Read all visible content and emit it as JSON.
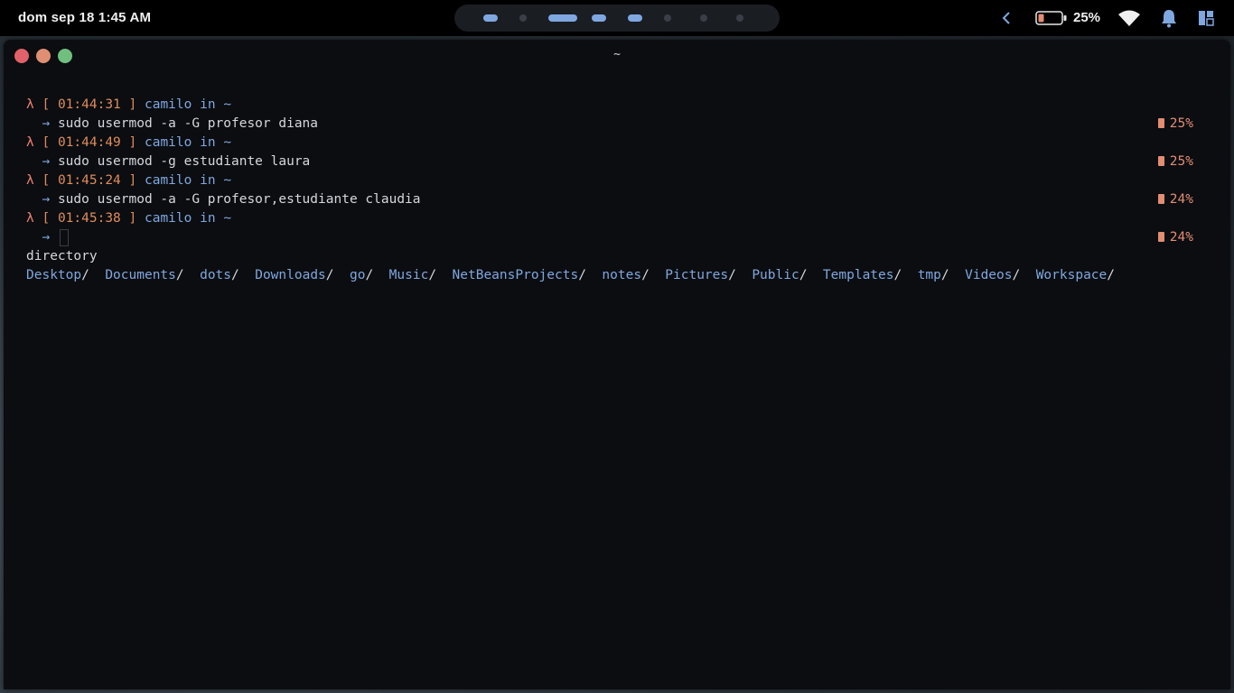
{
  "topbar": {
    "clock": "dom sep 18  1:45 AM",
    "battery_percent": "25%",
    "workspaces": [
      {
        "state": "active",
        "width": 16
      },
      {
        "state": "inactive",
        "width": 8
      },
      {
        "state": "active",
        "width": 32
      },
      {
        "state": "active",
        "width": 16
      },
      {
        "state": "active",
        "width": 16
      },
      {
        "state": "inactive",
        "width": 8
      },
      {
        "state": "inactive",
        "width": 8
      },
      {
        "state": "inactive",
        "width": 8
      }
    ],
    "icons": [
      "chevron-left-icon",
      "battery-icon",
      "wifi-icon",
      "bell-icon",
      "panel-icon"
    ]
  },
  "window": {
    "title": "~",
    "controls": [
      "close",
      "minimize",
      "maximize"
    ]
  },
  "terminal": {
    "prompts": [
      {
        "lambda": "λ",
        "open": "[",
        "time": "01:44:31",
        "close": "]",
        "user": "camilo",
        "in": "in",
        "dir": "~",
        "arrow": "→",
        "command": "sudo usermod -a -G profesor diana",
        "battery": "25%"
      },
      {
        "lambda": "λ",
        "open": "[",
        "time": "01:44:49",
        "close": "]",
        "user": "camilo",
        "in": "in",
        "dir": "~",
        "arrow": "→",
        "command": "sudo usermod -g estudiante laura",
        "battery": "25%"
      },
      {
        "lambda": "λ",
        "open": "[",
        "time": "01:45:24",
        "close": "]",
        "user": "camilo",
        "in": "in",
        "dir": "~",
        "arrow": "→",
        "command": "sudo usermod -a -G profesor,estudiante claudia",
        "battery": "24%"
      },
      {
        "lambda": "λ",
        "open": "[",
        "time": "01:45:38",
        "close": "]",
        "user": "camilo",
        "in": "in",
        "dir": "~",
        "arrow": "→",
        "command": "",
        "battery": "24%"
      }
    ],
    "completion_label": "directory",
    "directories": [
      "Desktop",
      "Documents",
      "dots",
      "Downloads",
      "go",
      "Music",
      "NetBeansProjects",
      "notes",
      "Pictures",
      "Public",
      "Templates",
      "tmp",
      "Videos",
      "Workspace"
    ]
  },
  "colors": {
    "accent": "#7fa7e0",
    "prompt_orange": "#e08b5c",
    "battery": "#e38d73",
    "background": "#0b0d10"
  }
}
